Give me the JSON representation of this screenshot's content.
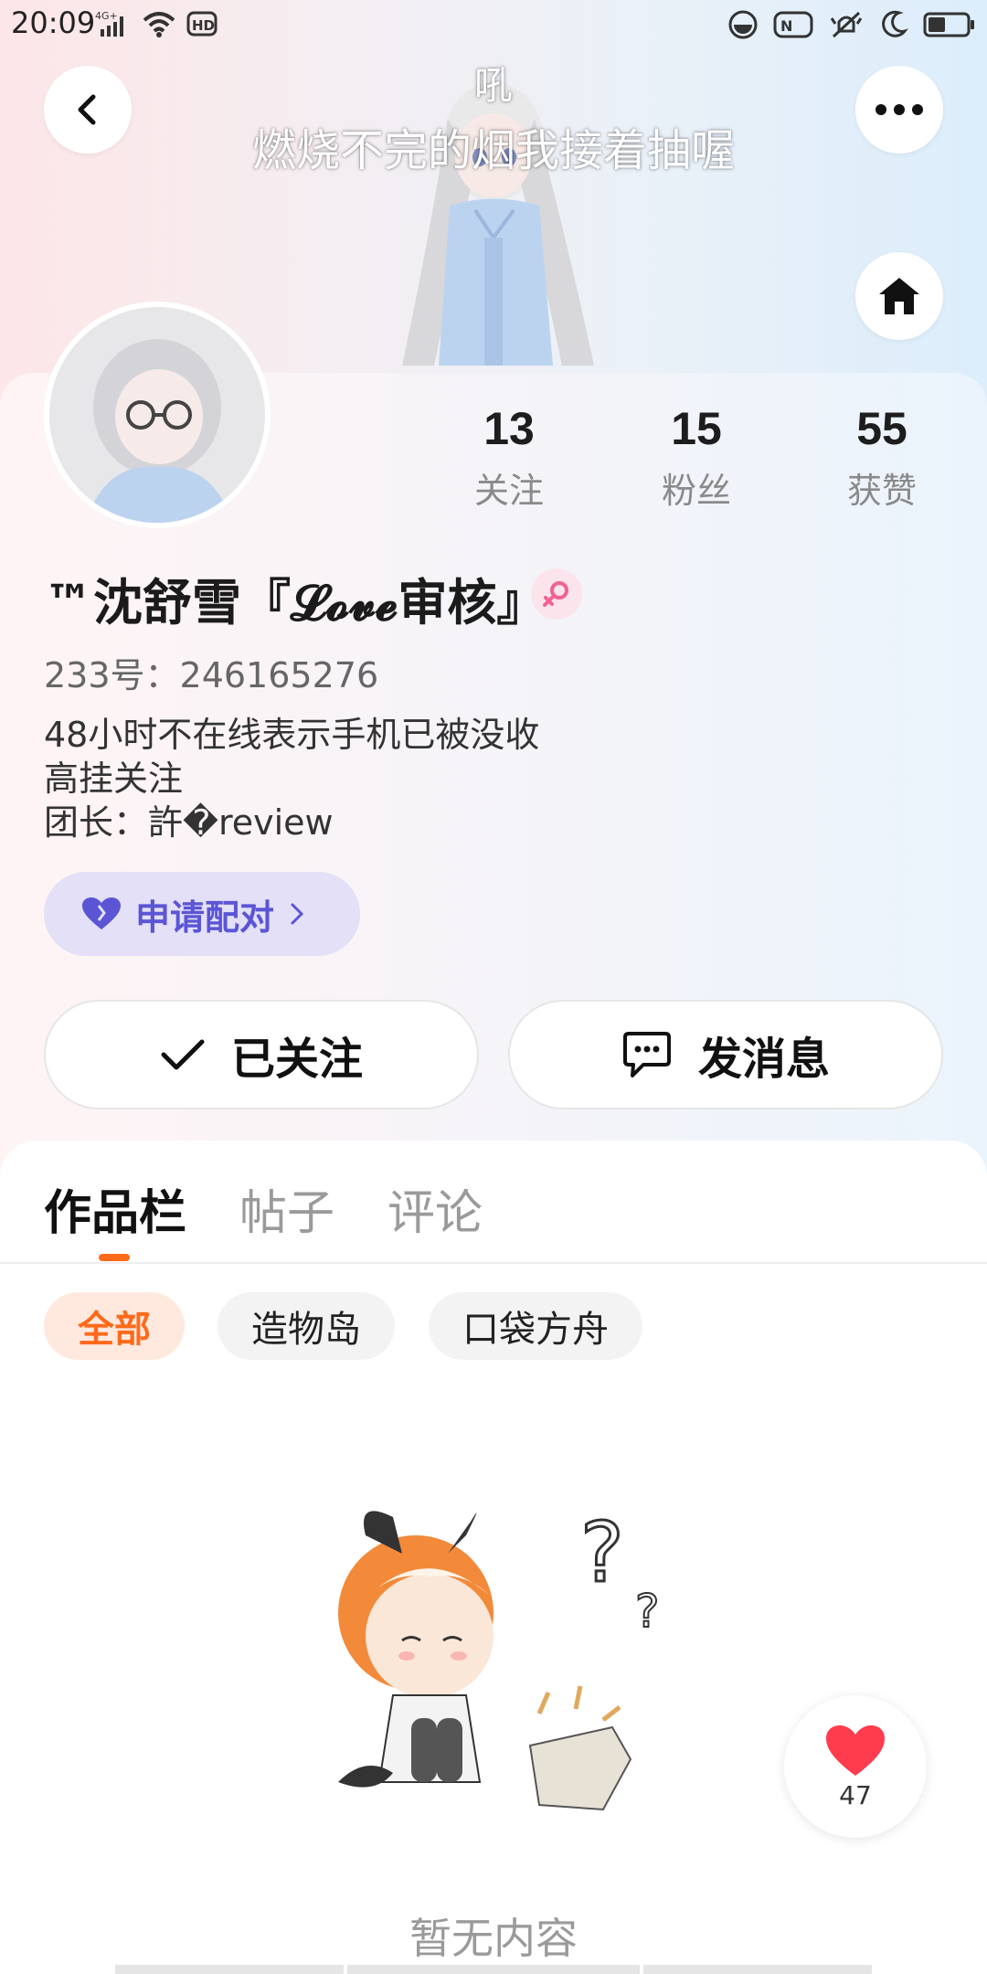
{
  "status_bar": {
    "time": "20:09",
    "network": "4G+",
    "hd": "HD",
    "icons_left": [
      "signal-icon",
      "wifi-icon",
      "hd-icon"
    ],
    "icons_right": [
      "data-saver-icon",
      "nfc-icon",
      "vibrate-icon",
      "moon-icon",
      "battery-icon"
    ]
  },
  "header": {
    "lyric_line_1": "吼",
    "lyric_line_2": "燃烧不完的烟我接着抽喔",
    "back_icon": "chevron-left-icon",
    "more_icon": "more-icon",
    "home_icon": "home-icon"
  },
  "profile": {
    "stats": [
      {
        "value": "13",
        "label": "关注"
      },
      {
        "value": "15",
        "label": "粉丝"
      },
      {
        "value": "55",
        "label": "获赞"
      }
    ],
    "nickname": "™沈舒雪『𝓛𝓸𝓿𝓮审核』",
    "gender": "female",
    "uid_line": "233号：246165276",
    "bio": [
      "48小时不在线表示手机已被没收",
      "高挂关注",
      "团长：許�review"
    ],
    "pair_button": "申请配对",
    "follow_button": "已关注",
    "message_button": "发消息"
  },
  "tabs": [
    "作品栏",
    "帖子",
    "评论"
  ],
  "filters": [
    "全部",
    "造物岛",
    "口袋方舟"
  ],
  "empty_text": "暂无内容",
  "like_count": "47",
  "colors": {
    "accent": "#ff6a1a",
    "pair_purple": "#5b55d6",
    "heart": "#ff3b4e"
  }
}
